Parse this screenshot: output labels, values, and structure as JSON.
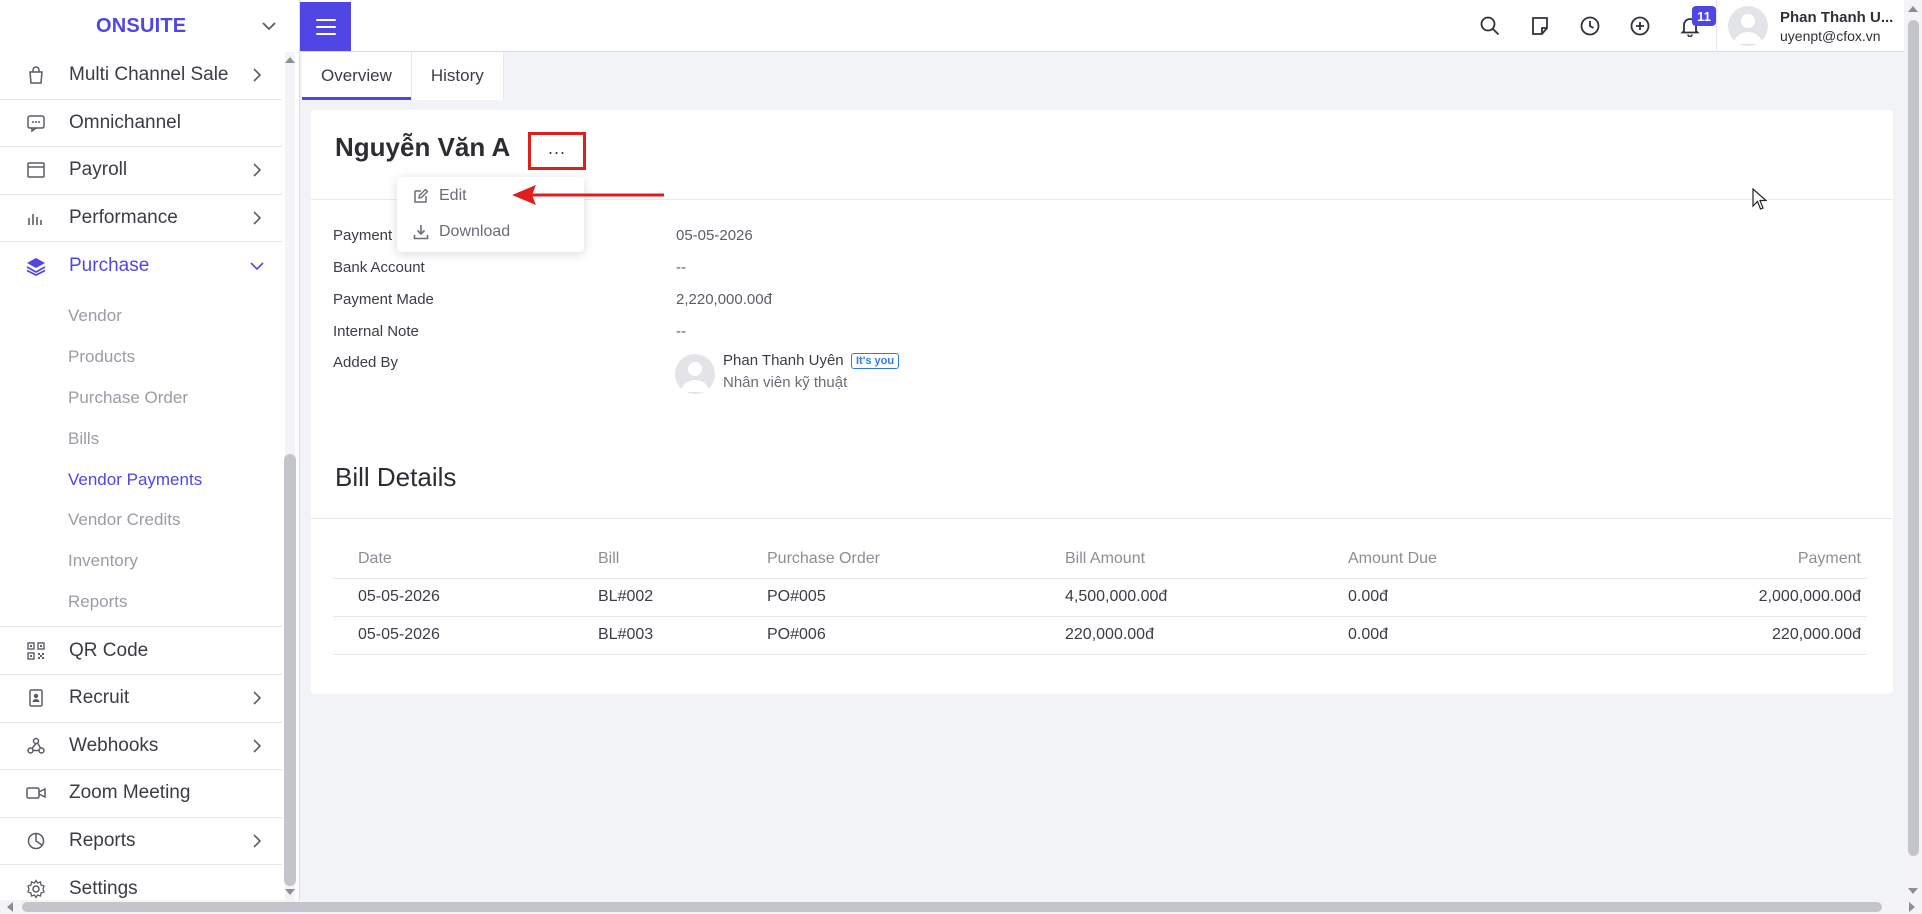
{
  "brand": {
    "name": "ONSUITE"
  },
  "sidebar": {
    "items": [
      {
        "label": "Multi Channel Sale",
        "icon": "shopping-bag-icon",
        "has_arrow": true
      },
      {
        "label": "Omnichannel",
        "icon": "chat-icon",
        "has_arrow": false
      },
      {
        "label": "Payroll",
        "icon": "window-icon",
        "has_arrow": true
      },
      {
        "label": "Performance",
        "icon": "bar-chart-icon",
        "has_arrow": true
      },
      {
        "label": "Purchase",
        "icon": "layers-icon",
        "expanded": true
      }
    ],
    "purchase_sub": [
      {
        "label": "Vendor"
      },
      {
        "label": "Products"
      },
      {
        "label": "Purchase Order"
      },
      {
        "label": "Bills"
      },
      {
        "label": "Vendor Payments",
        "active": true
      },
      {
        "label": "Vendor Credits"
      },
      {
        "label": "Inventory"
      },
      {
        "label": "Reports"
      }
    ],
    "items_after": [
      {
        "label": "QR Code",
        "icon": "qr-code-icon",
        "has_arrow": false
      },
      {
        "label": "Recruit",
        "icon": "id-card-icon",
        "has_arrow": true
      },
      {
        "label": "Webhooks",
        "icon": "webhook-icon",
        "has_arrow": true
      },
      {
        "label": "Zoom Meeting",
        "icon": "video-icon",
        "has_arrow": false
      },
      {
        "label": "Reports",
        "icon": "pie-chart-icon",
        "has_arrow": true
      },
      {
        "label": "Settings",
        "icon": "gear-icon",
        "has_arrow": false
      }
    ]
  },
  "topbar": {
    "notification_count": "11",
    "user": {
      "name": "Phan Thanh U...",
      "email": "uyenpt@cfox.vn"
    }
  },
  "tabs": [
    {
      "label": "Overview",
      "active": true
    },
    {
      "label": "History"
    }
  ],
  "payment": {
    "title": "Nguyễn Văn A",
    "more_label": "...",
    "dropdown": [
      {
        "label": "Edit",
        "icon": "edit-icon"
      },
      {
        "label": "Download",
        "icon": "download-icon"
      }
    ],
    "fields": [
      {
        "label": "Payment",
        "value": "05-05-2026"
      },
      {
        "label": "Bank Account",
        "value": "--"
      },
      {
        "label": "Payment Made",
        "value": "2,220,000.00đ"
      },
      {
        "label": "Internal Note",
        "value": "--"
      }
    ],
    "added_by": {
      "label": "Added By",
      "name": "Phan Thanh Uyên",
      "badge": "It's you",
      "role": "Nhân viên kỹ thuật"
    }
  },
  "bill_details": {
    "title": "Bill Details",
    "columns": [
      "Date",
      "Bill",
      "Purchase Order",
      "Bill Amount",
      "Amount Due",
      "Payment"
    ],
    "rows": [
      [
        "05-05-2026",
        "BL#002",
        "PO#005",
        "4,500,000.00đ",
        "0.00đ",
        "2,000,000.00đ"
      ],
      [
        "05-05-2026",
        "BL#003",
        "PO#006",
        "220,000.00đ",
        "0.00đ",
        "220,000.00đ"
      ]
    ]
  },
  "colors": {
    "accent": "#5046e5",
    "annotation": "#e01e1e",
    "badge_blue": "#2f7de1"
  }
}
